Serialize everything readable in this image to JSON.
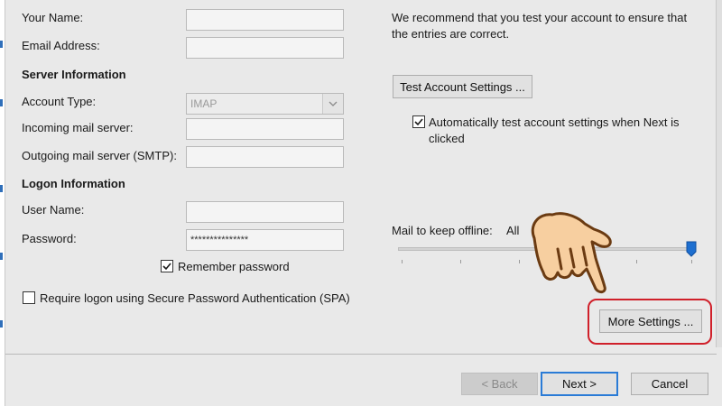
{
  "account": {
    "your_name_label": "Your Name:",
    "email_label": "Email Address:",
    "your_name_value": "",
    "email_value": ""
  },
  "server": {
    "header": "Server Information",
    "account_type_label": "Account Type:",
    "account_type_value": "IMAP",
    "incoming_label": "Incoming mail server:",
    "incoming_value": "",
    "outgoing_label": "Outgoing mail server (SMTP):",
    "outgoing_value": ""
  },
  "logon": {
    "header": "Logon Information",
    "username_label": "User Name:",
    "username_value": "",
    "password_label": "Password:",
    "password_value": "***************",
    "remember_label": "Remember password",
    "remember_checked": true,
    "spa_label": "Require logon using Secure Password Authentication (SPA)",
    "spa_checked": false
  },
  "test": {
    "recommend_text": "We recommend that you test your account to ensure that the entries are correct.",
    "test_button": "Test Account Settings ...",
    "auto_test_label": "Automatically test account settings when Next is clicked",
    "auto_test_checked": true
  },
  "offline": {
    "label": "Mail to keep offline:",
    "value": "All",
    "slider_level": "All"
  },
  "more_settings_button": "More Settings ...",
  "footer": {
    "back": "< Back",
    "next": "Next >",
    "cancel": "Cancel"
  },
  "colors": {
    "highlight_box": "#d0202a",
    "accent": "#2a7bd6",
    "pointer_hand": "#f7cfa0"
  },
  "icons": [
    "check-icon",
    "dropdown-chevron-icon",
    "pointing-hand-icon",
    "slider-thumb-icon"
  ]
}
